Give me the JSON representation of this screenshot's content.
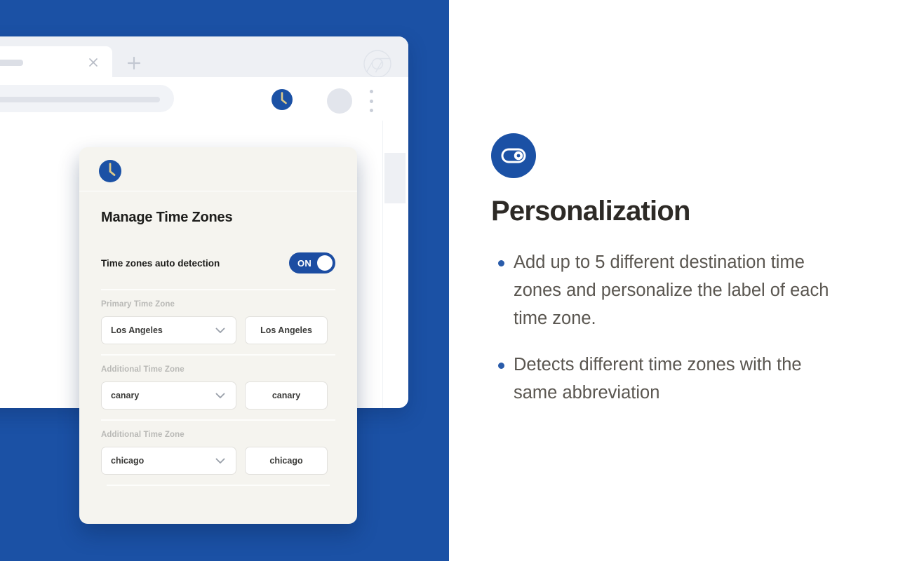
{
  "browser": {
    "tab_close_icon": "close-icon",
    "new_tab_icon": "plus-icon",
    "chrome_logo_icon": "chrome-logo-icon",
    "lock_icon": "lock-icon",
    "extension_icon": "clock-crescent-icon",
    "avatar_icon": "avatar",
    "menu_icon": "kebab-menu-icon"
  },
  "popup": {
    "logo_icon": "clock-crescent-logo",
    "title": "Manage Time Zones",
    "auto_detection": {
      "label": "Time zones auto detection",
      "toggle_state": "ON"
    },
    "zones": [
      {
        "label": "Primary Time Zone",
        "select_value": "Los Angeles",
        "input_value": "Los Angeles",
        "chevron_icon": "chevron-down-icon"
      },
      {
        "label": "Additional Time Zone",
        "select_value": "canary",
        "input_value": "canary",
        "chevron_icon": "chevron-down-icon"
      },
      {
        "label": "Additional Time Zone",
        "select_value": "chicago",
        "input_value": "chicago",
        "chevron_icon": "chevron-down-icon"
      }
    ]
  },
  "feature": {
    "icon": "toggle-switch-icon",
    "title": "Personalization",
    "bullets": [
      "Add up to 5 different destination time zones and personalize the label of each time zone.",
      "Detects different time zones with the same abbreviation"
    ]
  },
  "colors": {
    "brand_blue": "#1b51a5",
    "toggle_blue": "#1c4da2",
    "bullet_blue": "#2a5caa",
    "popup_bg": "#f5f4ef",
    "gold": "#dbc98a",
    "heading": "#2d2a26",
    "body_text": "#5a5650"
  }
}
